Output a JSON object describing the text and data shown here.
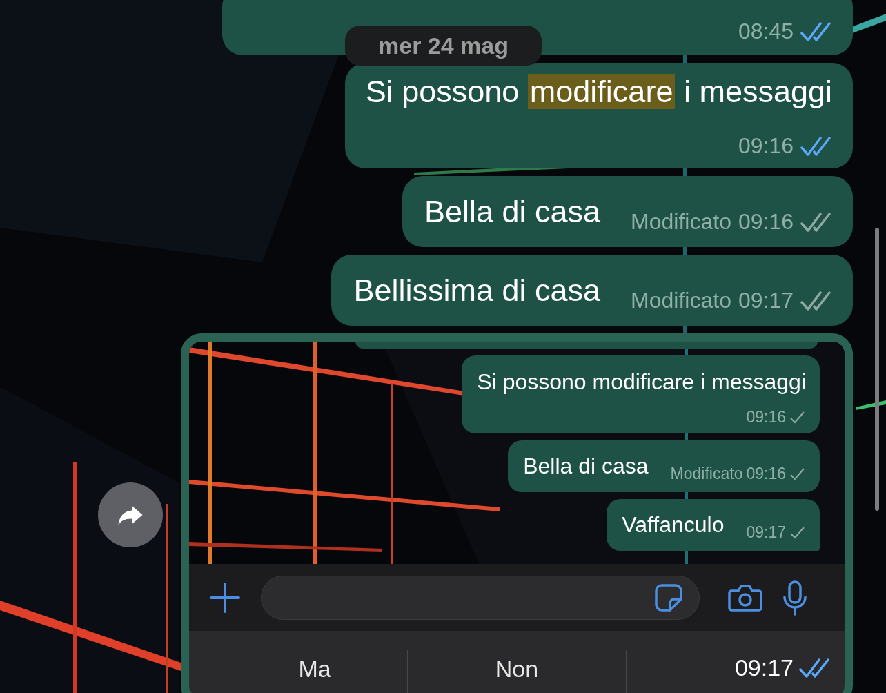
{
  "date_pill": "mer 24 mag",
  "messages": [
    {
      "kind": "cut",
      "time": "08:45",
      "read": true
    },
    {
      "kind": "stacked",
      "segments": [
        {
          "text": "Si possono ",
          "highlighted": false
        },
        {
          "text": "modificare",
          "highlighted": true
        },
        {
          "text": " i messaggi",
          "highlighted": false
        }
      ],
      "time": "09:16",
      "read": true
    },
    {
      "kind": "inline",
      "text": "Bella di casa",
      "edited": "Modificato",
      "time": "09:16",
      "read": false
    },
    {
      "kind": "inline",
      "text": "Bellissima di casa",
      "edited": "Modificato",
      "time": "09:17",
      "read": false
    },
    {
      "time": "09:17",
      "read": true,
      "screenshot": {
        "messages": [
          {
            "kind": "stacked",
            "text": "Si possono modificare i messaggi",
            "time": "09:16",
            "delivered": false
          },
          {
            "kind": "inline",
            "text": "Bella di casa",
            "edited": "Modificato",
            "time": "09:16",
            "delivered": false
          },
          {
            "kind": "inline",
            "text": "Vaffanculo",
            "time": "09:17",
            "delivered": false
          }
        ],
        "suggestions": [
          "Ma",
          "Non"
        ]
      }
    }
  ]
}
